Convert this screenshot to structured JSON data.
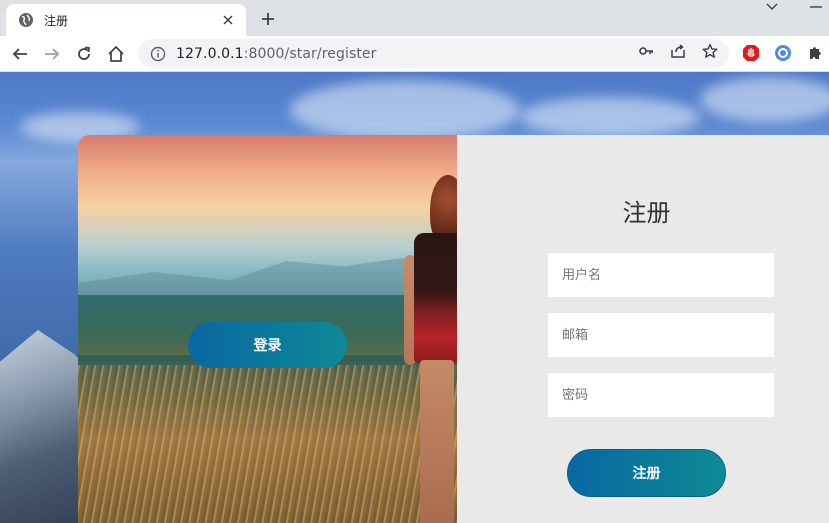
{
  "browser": {
    "tab_title": "注册",
    "url_host": "127.0.0.1",
    "url_rest": ":8000/star/register"
  },
  "page": {
    "login_button": "登录",
    "register_title": "注册",
    "username_placeholder": "用户名",
    "email_placeholder": "邮箱",
    "password_placeholder": "密码",
    "register_button": "注册"
  },
  "colors": {
    "button_gradient_start": "#0a67a3",
    "button_gradient_end": "#0e8a95",
    "form_panel_bg": "#e9e9e9"
  }
}
